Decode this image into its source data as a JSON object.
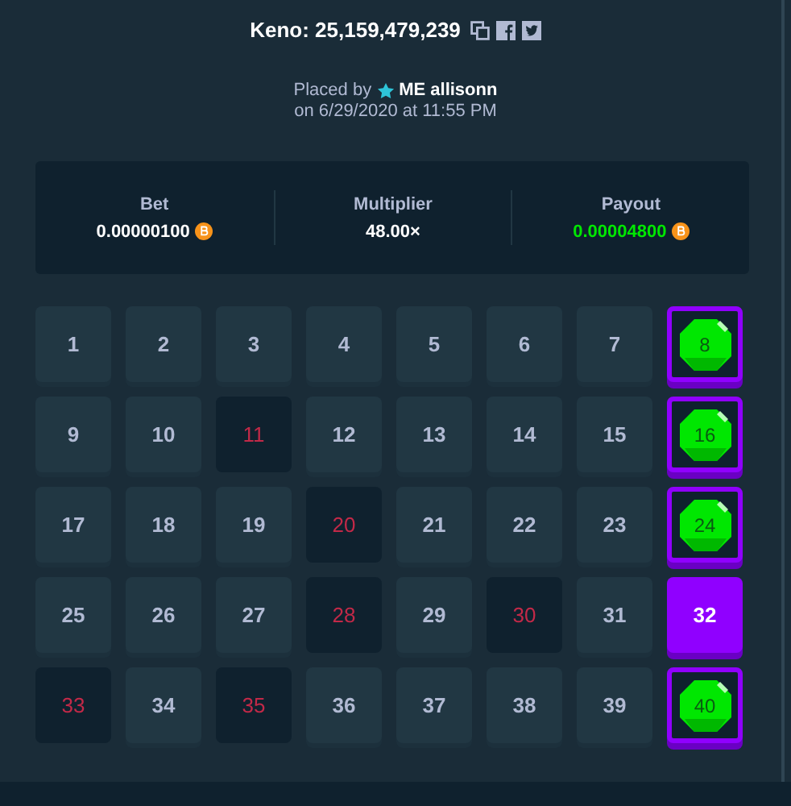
{
  "header": {
    "title": "Keno: 25,159,479,239"
  },
  "placed": {
    "prefix": "Placed by",
    "user": "ME allisonn",
    "date": "on 6/29/2020 at 11:55 PM"
  },
  "stats": [
    {
      "label": "Bet",
      "value": "0.00000100",
      "kind": "coin"
    },
    {
      "label": "Multiplier",
      "value": "48.00×",
      "kind": "plain"
    },
    {
      "label": "Payout",
      "value": "0.00004800",
      "kind": "win"
    }
  ],
  "tiles": [
    {
      "number": "1",
      "picked": false,
      "drawn": false
    },
    {
      "number": "2",
      "picked": false,
      "drawn": false
    },
    {
      "number": "3",
      "picked": false,
      "drawn": false
    },
    {
      "number": "4",
      "picked": false,
      "drawn": false
    },
    {
      "number": "5",
      "picked": false,
      "drawn": false
    },
    {
      "number": "6",
      "picked": false,
      "drawn": false
    },
    {
      "number": "7",
      "picked": false,
      "drawn": false
    },
    {
      "number": "8",
      "picked": true,
      "drawn": true
    },
    {
      "number": "9",
      "picked": false,
      "drawn": false
    },
    {
      "number": "10",
      "picked": false,
      "drawn": false
    },
    {
      "number": "11",
      "picked": false,
      "drawn": true
    },
    {
      "number": "12",
      "picked": false,
      "drawn": false
    },
    {
      "number": "13",
      "picked": false,
      "drawn": false
    },
    {
      "number": "14",
      "picked": false,
      "drawn": false
    },
    {
      "number": "15",
      "picked": false,
      "drawn": false
    },
    {
      "number": "16",
      "picked": true,
      "drawn": true
    },
    {
      "number": "17",
      "picked": false,
      "drawn": false
    },
    {
      "number": "18",
      "picked": false,
      "drawn": false
    },
    {
      "number": "19",
      "picked": false,
      "drawn": false
    },
    {
      "number": "20",
      "picked": false,
      "drawn": true
    },
    {
      "number": "21",
      "picked": false,
      "drawn": false
    },
    {
      "number": "22",
      "picked": false,
      "drawn": false
    },
    {
      "number": "23",
      "picked": false,
      "drawn": false
    },
    {
      "number": "24",
      "picked": true,
      "drawn": true
    },
    {
      "number": "25",
      "picked": false,
      "drawn": false
    },
    {
      "number": "26",
      "picked": false,
      "drawn": false
    },
    {
      "number": "27",
      "picked": false,
      "drawn": false
    },
    {
      "number": "28",
      "picked": false,
      "drawn": true
    },
    {
      "number": "29",
      "picked": false,
      "drawn": false
    },
    {
      "number": "30",
      "picked": false,
      "drawn": true
    },
    {
      "number": "31",
      "picked": false,
      "drawn": false
    },
    {
      "number": "32",
      "picked": true,
      "drawn": false
    },
    {
      "number": "33",
      "picked": false,
      "drawn": true
    },
    {
      "number": "34",
      "picked": false,
      "drawn": false
    },
    {
      "number": "35",
      "picked": false,
      "drawn": true
    },
    {
      "number": "36",
      "picked": false,
      "drawn": false
    },
    {
      "number": "37",
      "picked": false,
      "drawn": false
    },
    {
      "number": "38",
      "picked": false,
      "drawn": false
    },
    {
      "number": "39",
      "picked": false,
      "drawn": false
    },
    {
      "number": "40",
      "picked": true,
      "drawn": true
    }
  ]
}
